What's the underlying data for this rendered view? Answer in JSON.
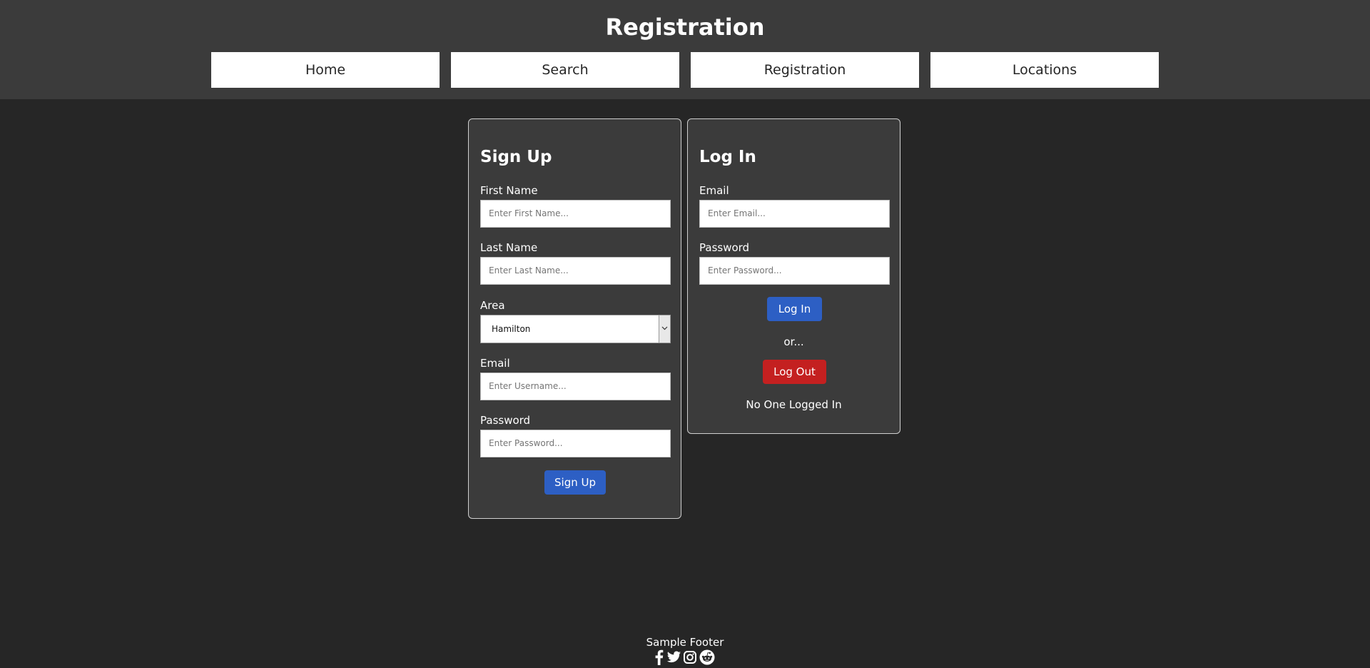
{
  "header": {
    "title": "Registration",
    "nav": [
      "Home",
      "Search",
      "Registration",
      "Locations"
    ]
  },
  "signup": {
    "title": "Sign Up",
    "first_name_label": "First Name",
    "first_name_placeholder": "Enter First Name...",
    "last_name_label": "Last Name",
    "last_name_placeholder": "Enter Last Name...",
    "area_label": "Area",
    "area_value": "Hamilton",
    "email_label": "Email",
    "email_placeholder": "Enter Username...",
    "password_label": "Password",
    "password_placeholder": "Enter Password...",
    "button": "Sign Up"
  },
  "login": {
    "title": "Log In",
    "email_label": "Email",
    "email_placeholder": "Enter Email...",
    "password_label": "Password",
    "password_placeholder": "Enter Password...",
    "login_button": "Log In",
    "or_text": "or...",
    "logout_button": "Log Out",
    "status": "No One Logged In"
  },
  "footer": {
    "text": "Sample Footer",
    "icons": [
      "facebook-icon",
      "twitter-icon",
      "instagram-icon",
      "reddit-icon"
    ]
  },
  "colors": {
    "background": "#262626",
    "header_background": "#3b3b3b",
    "primary_button": "#2d5fc4",
    "danger_button": "#c42020"
  }
}
